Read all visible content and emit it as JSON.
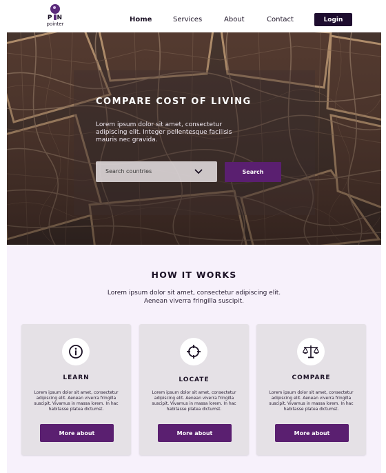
{
  "logo": {
    "brand_top_left": "P",
    "brand_top_right": "N",
    "brand_sub": "pointer",
    "icon": "map-pin-icon"
  },
  "nav": {
    "items": [
      {
        "label": "Home",
        "active": true
      },
      {
        "label": "Services",
        "active": false
      },
      {
        "label": "About",
        "active": false
      },
      {
        "label": "Contact",
        "active": false
      }
    ],
    "login_label": "Login"
  },
  "hero": {
    "title": "COMPARE COST OF LIVING",
    "text": "Lorem ipsum dolor sit amet, consectetur adipiscing elit. Integer pellentesque facilisis mauris nec gravida.",
    "search": {
      "placeholder": "Search countries",
      "icon": "chevron-down-icon"
    },
    "search_button": "Search"
  },
  "how_it_works": {
    "title": "HOW IT WORKS",
    "subtitle_line1": "Lorem ipsum dolor sit amet, consectetur adipiscing elit.",
    "subtitle_line2": "Aenean viverra fringilla suscipit.",
    "cards": [
      {
        "title": "LEARN",
        "icon": "info-icon",
        "text": "Lorem ipsum dolor sit amet, consectetur adipiscing elit. Aenean viverra fringilla suscipit. Vivamus in massa lorem. In hac habitasse platea dictumst.",
        "button": "More about"
      },
      {
        "title": "LOCATE",
        "icon": "crosshair-icon",
        "text": "Lorem ipsum dolor sit amet, consectetur adipiscing elit. Aenean viverra fringilla suscipit. Vivamus in massa lorem. In hac habitasse platea dictumst.",
        "button": "More about"
      },
      {
        "title": "COMPARE",
        "icon": "scales-icon",
        "text": "Lorem ipsum dolor sit amet, consectetur adipiscing elit. Aenean viverra fringilla suscipit. Vivamus in massa lorem. In hac habitasse platea dictumst.",
        "button": "More about"
      }
    ]
  },
  "colors": {
    "primary": "#5a1f70",
    "dark": "#1e0d2f",
    "section_bg": "#f7f1fb",
    "card_bg": "#e5e1e6"
  }
}
